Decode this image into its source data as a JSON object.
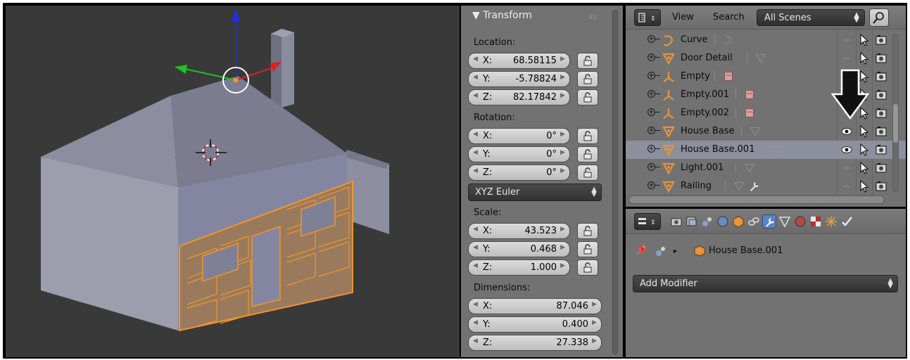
{
  "transform_panel": {
    "title": "Transform",
    "location": {
      "label": "Location:",
      "fields": [
        {
          "axis": "X:",
          "value": "68.58115"
        },
        {
          "axis": "Y:",
          "value": "-5.78824"
        },
        {
          "axis": "Z:",
          "value": "82.17842"
        }
      ]
    },
    "rotation": {
      "label": "Rotation:",
      "fields": [
        {
          "axis": "X:",
          "value": "0°"
        },
        {
          "axis": "Y:",
          "value": "0°"
        },
        {
          "axis": "Z:",
          "value": "0°"
        }
      ]
    },
    "rotation_mode": "XYZ Euler",
    "scale": {
      "label": "Scale:",
      "fields": [
        {
          "axis": "X:",
          "value": "43.523"
        },
        {
          "axis": "Y:",
          "value": "0.468"
        },
        {
          "axis": "Z:",
          "value": "1.000"
        }
      ]
    },
    "dimensions": {
      "label": "Dimensions:",
      "fields": [
        {
          "axis": "X:",
          "value": "87.046"
        },
        {
          "axis": "Y:",
          "value": "0.400"
        },
        {
          "axis": "Z:",
          "value": "27.338"
        }
      ]
    }
  },
  "outliner": {
    "menus": {
      "view": "View",
      "search": "Search"
    },
    "scene_filter": "All Scenes",
    "items": [
      {
        "name": "Curve",
        "type": "curve",
        "visible": false,
        "selected": false
      },
      {
        "name": "Door Detail",
        "type": "mesh",
        "visible": false,
        "selected": false
      },
      {
        "name": "Empty",
        "type": "empty",
        "visible": false,
        "selected": false
      },
      {
        "name": "Empty.001",
        "type": "empty",
        "visible": false,
        "selected": false
      },
      {
        "name": "Empty.002",
        "type": "empty",
        "visible": false,
        "selected": false
      },
      {
        "name": "House Base",
        "type": "mesh",
        "visible": true,
        "selected": false
      },
      {
        "name": "House Base.001",
        "type": "mesh",
        "visible": true,
        "selected": true
      },
      {
        "name": "Light.001",
        "type": "mesh",
        "visible": false,
        "selected": false
      },
      {
        "name": "Railing",
        "type": "mesh",
        "visible": false,
        "selected": false
      }
    ]
  },
  "properties": {
    "active_tab": "modifiers-icon",
    "breadcrumb_object": "House Base.001",
    "add_modifier": "Add Modifier"
  },
  "colors": {
    "panel_bg": "#727272",
    "viewport_bg": "#393939",
    "selection_orange": "#f0962a",
    "active_tab_blue": "#5b83c4",
    "gizmo_x": "#e02020",
    "gizmo_y": "#20c020",
    "gizmo_z": "#2030e0"
  }
}
